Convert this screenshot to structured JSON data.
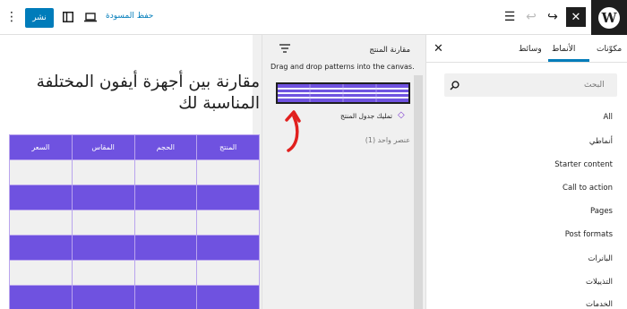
{
  "toolbar": {
    "publish_label": "نشر",
    "save_draft_label": "حفظ المسودة"
  },
  "inserter": {
    "tabs": [
      {
        "label": "مكوّنات"
      },
      {
        "label": "الأنماط"
      },
      {
        "label": "وسائط"
      }
    ],
    "active_tab": "الأنماط",
    "search_placeholder": "البحث",
    "categories": [
      {
        "label": "All"
      },
      {
        "label": "أنماطي"
      },
      {
        "label": "Starter content"
      },
      {
        "label": "Call to action"
      },
      {
        "label": "Pages"
      },
      {
        "label": "Post formats"
      },
      {
        "label": "البانرات"
      },
      {
        "label": "التذييلات"
      },
      {
        "label": "الخدمات"
      }
    ]
  },
  "explorer": {
    "title": "مقارنة المنتج",
    "hint": "Drag and drop patterns into the canvas.",
    "pattern_name": "تمليك جدول المنتج",
    "count_label": "عنصر واحد (1)"
  },
  "canvas": {
    "heading": "مقارنة بين أجهزة أيفون المختلفة المناسبة لك",
    "table": {
      "headers": [
        "المنتج",
        "الحجم",
        "المقاس",
        "السعر"
      ],
      "rows": [
        [
          "",
          "",
          "",
          ""
        ],
        [
          "",
          "",
          "",
          ""
        ],
        [
          "",
          "",
          "",
          ""
        ],
        [
          "",
          "",
          "",
          ""
        ],
        [
          "",
          "",
          "",
          ""
        ],
        [
          "",
          "",
          "",
          ""
        ]
      ]
    }
  },
  "colors": {
    "accent": "#007cba",
    "table_purple": "#6f52e0",
    "arrow_red": "#e1201e"
  }
}
